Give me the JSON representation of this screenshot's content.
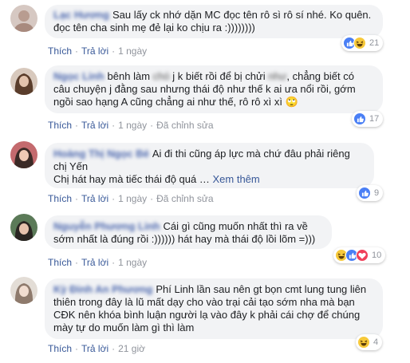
{
  "actions": {
    "like": "Thích",
    "reply": "Trả lời",
    "dot": "·",
    "edited": "Đã chỉnh sửa",
    "see_more": "Xem thêm",
    "ellipsis": "…"
  },
  "comments": [
    {
      "author": "Lạc Hương",
      "text": "Sau lấy ck nhớ dặn MC đọc tên rô sì rô sí nhé. Ko quên.\nđọc tên cha sinh mẹ đẻ lại ko chịu ra :))))))))",
      "time": "1 ngày",
      "reaction_count": "21",
      "reactions": [
        "like-icon",
        "haha-icon"
      ],
      "avatar_color": "#c9b7b0"
    },
    {
      "author": "Ngọc Linh",
      "text_parts": [
        "bênh làm ",
        "chó",
        " j k biết rồi để bị chửi ",
        "như",
        ", chẳng biết có câu chuyện j đằng sau nhưng thái độ như thế k ai ưa nổi rồi, gớm ngồi sao hạng A cũng chẳng ai như thế, rô rô xì xì ",
        "🙄"
      ],
      "time": "1 ngày",
      "reaction_count": "17",
      "reactions": [
        "like-icon"
      ],
      "avatar_color": "#7a5a46"
    },
    {
      "author": "Hoàng Thị Ngọc Bé",
      "text": "Ai đi thi cũng áp lực mà chứ đâu phải riêng chị Yến\nChị hát hay mà tiếc thái độ quá",
      "time": "1 ngày",
      "reaction_count": "9",
      "reactions": [
        "like-icon"
      ],
      "avatar_color": "#b44a52"
    },
    {
      "author": "Nguyễn Phương Linh",
      "text": "Cái gì cũng muốn nhất thì ra về sớm nhất là đúng rồi :)))))) hát hay mà thái độ lồi lõm =)))",
      "time": "1 ngày",
      "reaction_count": "10",
      "reactions": [
        "haha-icon",
        "like-icon",
        "love-icon"
      ],
      "avatar_color": "#4f6a4a"
    },
    {
      "author": "Kỳ Đinh An Phương",
      "text": "Phí Linh lần sau nên gt bọn cmt lung tung liên thiên trong đây là lũ mất dạy cho vào trại cải tạo sớm nha mà bạn CĐK nên khóa bình luận người lạ vào đây k phải cái chợ để chúng mày tự do muốn làm gì thì làm",
      "time": "21 giờ",
      "reaction_count": "4",
      "reactions": [
        "haha-icon"
      ],
      "avatar_color": "#d9d3cd"
    }
  ]
}
